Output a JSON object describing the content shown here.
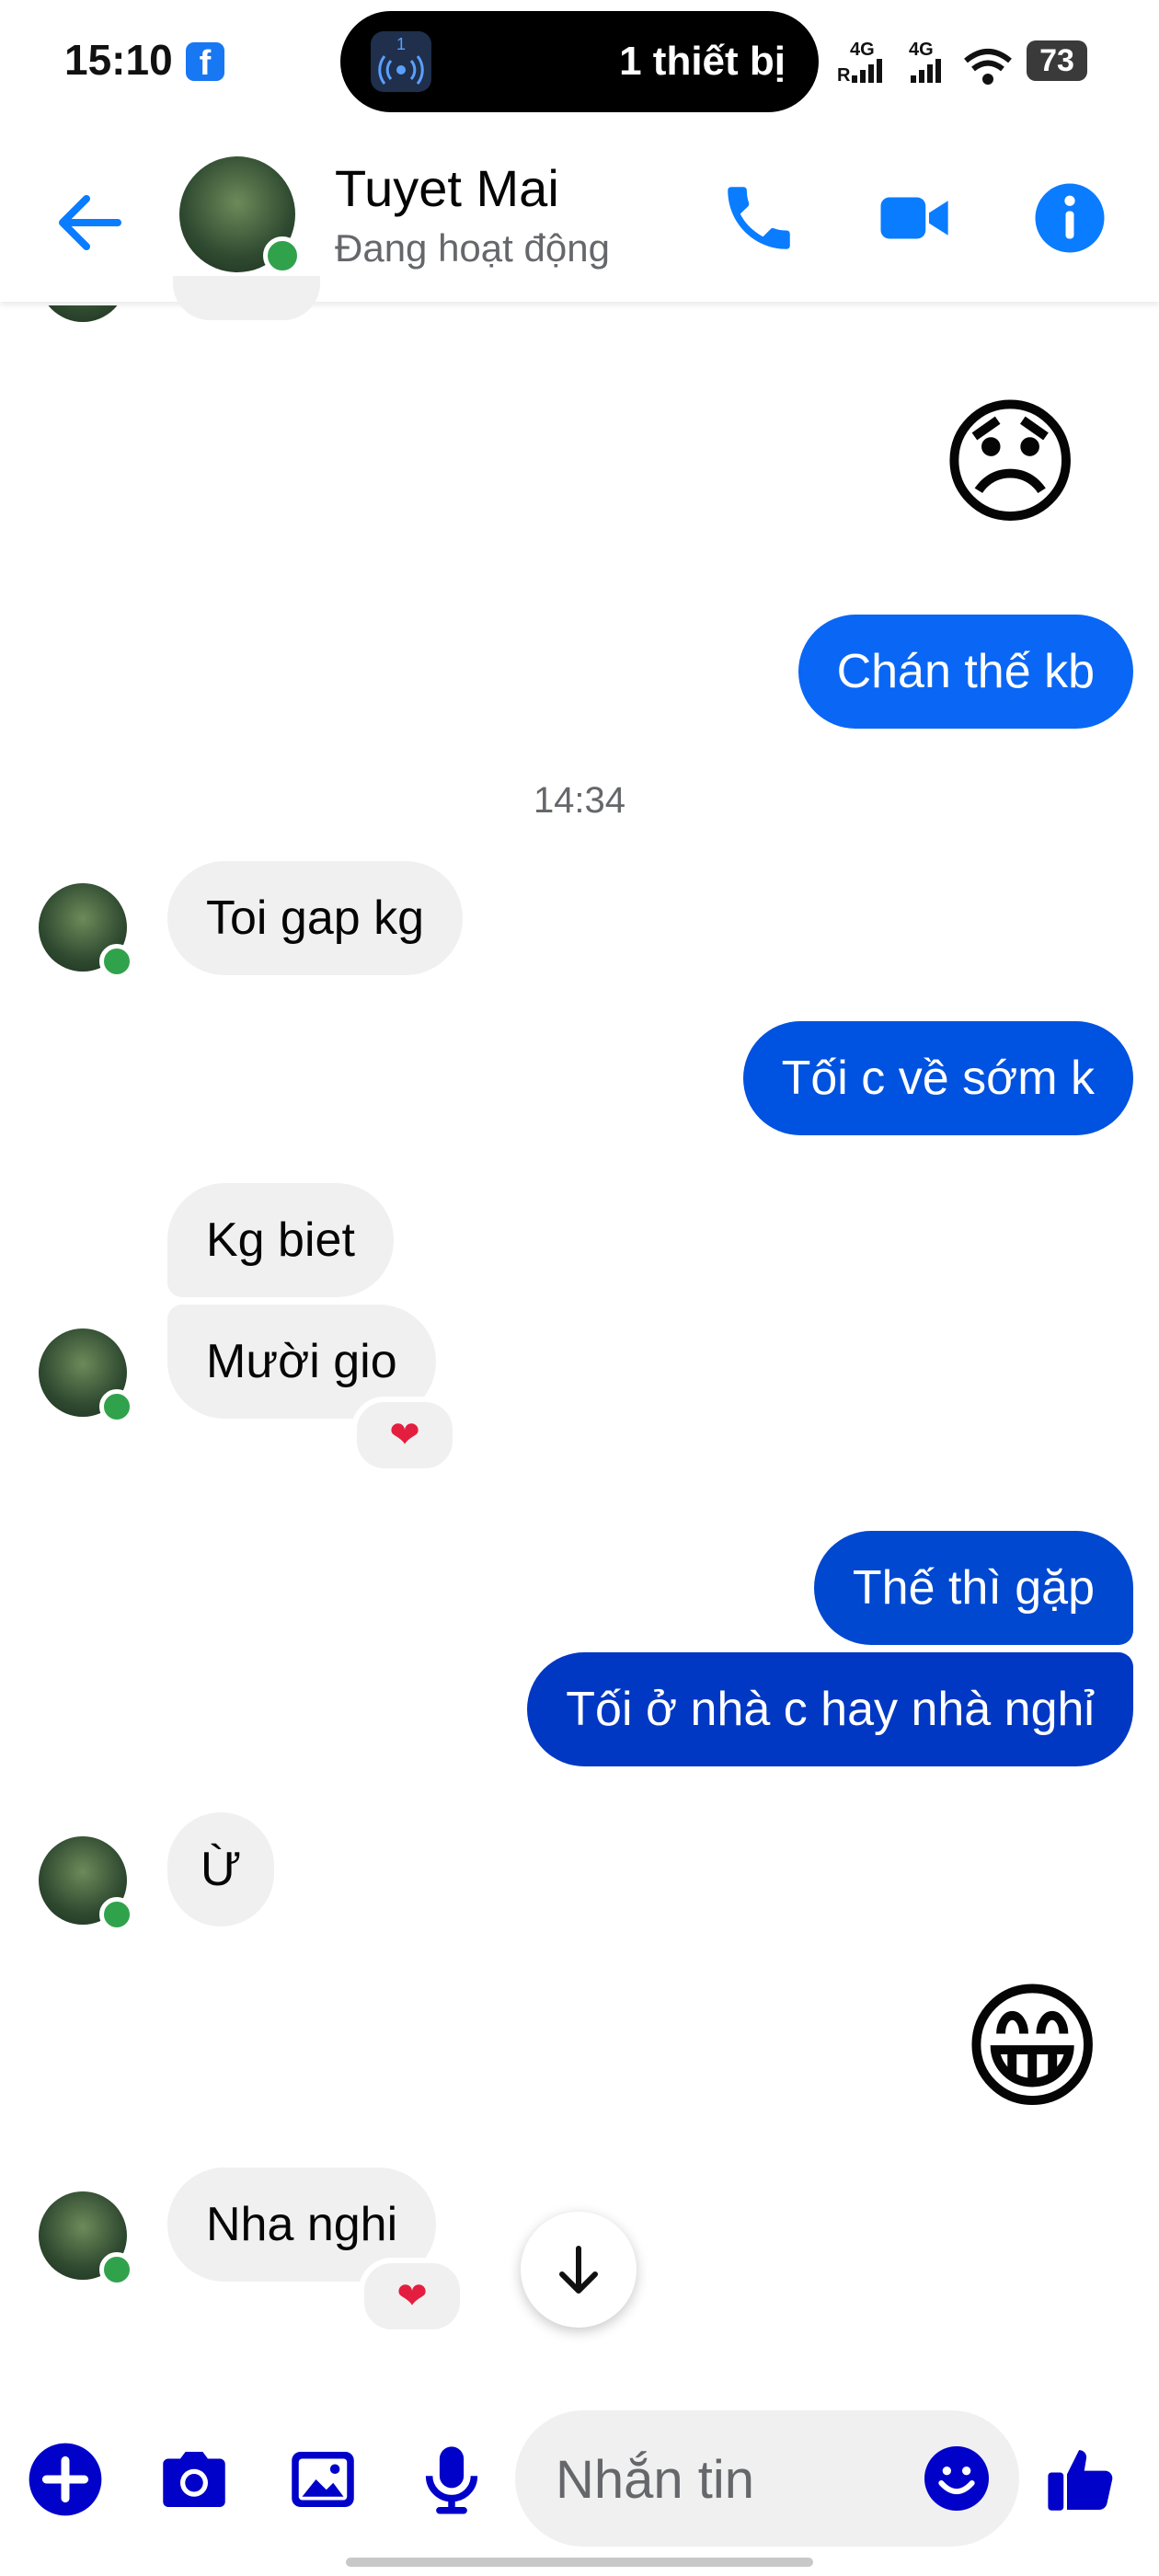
{
  "status_bar": {
    "time": "15:10",
    "app_badge": "f",
    "island_text": "1 thiết bị",
    "island_badge": "1",
    "network_1": "4G",
    "network_1_sub": "R",
    "network_2": "4G",
    "battery": "73"
  },
  "header": {
    "contact_name": "Tuyet Mai",
    "contact_status": "Đang hoạt động"
  },
  "chat": {
    "emoji_1": "😞",
    "msg_1": "Chán thế kb",
    "timestamp": "14:34",
    "msg_2": "Toi gap kg",
    "msg_3": "Tối c về sớm k",
    "msg_4": "Kg biet",
    "msg_5": "Mười gio",
    "reaction_5": "❤",
    "msg_6": "Thế thì gặp",
    "msg_7": "Tối ở nhà c hay nhà nghỉ",
    "msg_8": "Ừ",
    "emoji_2": "😁",
    "msg_9": "Nha nghi",
    "reaction_9": "❤"
  },
  "composer": {
    "placeholder": "Nhắn tin"
  },
  "colors": {
    "brand": "#0a7cff",
    "accent": "#0001c9",
    "online": "#31a24c",
    "bubble_out_light": "#0a67f5",
    "bubble_out_dark": "#0044d8",
    "bubble_in": "#f0f0f0"
  }
}
